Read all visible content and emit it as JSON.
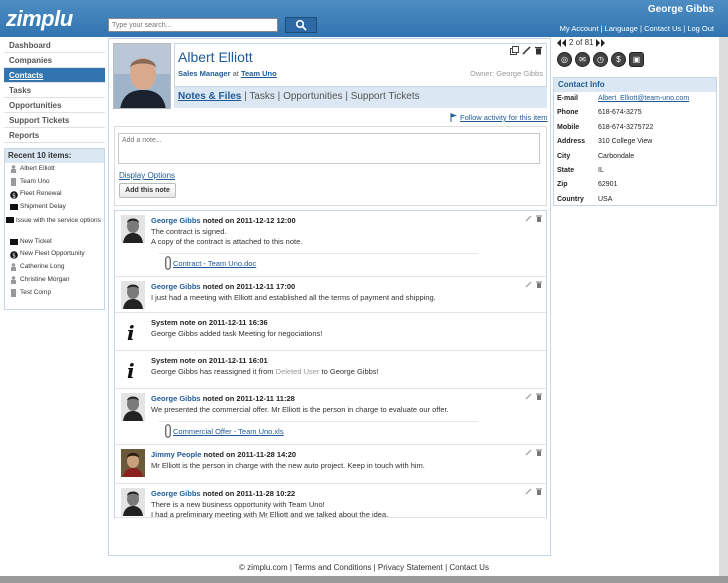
{
  "header": {
    "logo": "zimplu",
    "search_placeholder": "Type your search...",
    "user_name": "George Gibbs",
    "links": [
      "My Account",
      "Language",
      "Contact Us",
      "Log Out"
    ]
  },
  "nav": {
    "items": [
      {
        "label": "Dashboard",
        "active": false
      },
      {
        "label": "Companies",
        "active": false
      },
      {
        "label": "Contacts",
        "active": true
      },
      {
        "label": "Tasks",
        "active": false
      },
      {
        "label": "Opportunities",
        "active": false
      },
      {
        "label": "Support Tickets",
        "active": false
      },
      {
        "label": "Reports",
        "active": false
      }
    ]
  },
  "recent": {
    "title": "Recent 10 items:",
    "items": [
      {
        "label": "Albert Elliott",
        "icon": "person-icon"
      },
      {
        "label": "Team Uno",
        "icon": "building-icon"
      },
      {
        "label": "Fleet Renewal",
        "icon": "dollar-icon"
      },
      {
        "label": "Shipment Delay",
        "icon": "ticket-icon"
      },
      {
        "label": "Issue with the service options",
        "icon": "ticket-icon"
      },
      {
        "label": "New Ticket",
        "icon": "ticket-icon"
      },
      {
        "label": "New Fleet Opportunity",
        "icon": "dollar-icon"
      },
      {
        "label": "Catherine Long",
        "icon": "person-icon"
      },
      {
        "label": "Christine Morgan",
        "icon": "person-icon"
      },
      {
        "label": "Test Comp",
        "icon": "building-icon"
      }
    ]
  },
  "contact": {
    "name": "Albert Elliott",
    "role": "Sales Manager",
    "at": "at",
    "company": "Team Uno",
    "owner": "Owner: George Gibbs"
  },
  "tabs": [
    "Notes & Files",
    "Tasks",
    "Opportunities",
    "Support Tickets"
  ],
  "follow_label": "Follow activity for this item",
  "note": {
    "placeholder": "Add a note...",
    "display_options": "Display Options",
    "add_button": "Add this note"
  },
  "feed": [
    {
      "author": "George Gibbs",
      "verb": "noted on 2011-12-12 12:00",
      "lines": [
        "The contract is signed.",
        "A copy of the contract is attached to this note."
      ],
      "attachment": "Contract - Team Uno.doc",
      "avatar": "gg",
      "system": false
    },
    {
      "author": "George Gibbs",
      "verb": "noted on 2011-12-11 17:00",
      "lines": [
        "I just had a meeting with Elliott and established all the terms of payment and shipping."
      ],
      "attachment": "",
      "avatar": "gg",
      "system": false
    },
    {
      "author": "",
      "verb": "System note on 2011-12-11 16:36",
      "lines": [
        "George Gibbs added task Meeting for negociations!"
      ],
      "attachment": "",
      "avatar": "info",
      "system": true
    },
    {
      "author": "",
      "verb": "System note on 2011-12-11 16:01",
      "lines": [
        "George Gibbs has reassigned it from Deleted User to George Gibbs!"
      ],
      "attachment": "",
      "avatar": "info",
      "system": true
    },
    {
      "author": "George Gibbs",
      "verb": "noted on 2011-12-11 11:28",
      "lines": [
        "We presented the commercial offer. Mr Elliott is the person in charge to evaluate our offer."
      ],
      "attachment": "Commercial Offer - Team Uno.xls",
      "avatar": "gg",
      "system": false
    },
    {
      "author": "Jimmy People",
      "verb": "noted on 2011-11-28 14:20",
      "lines": [
        "Mr Elliott is the person in charge with the new auto project. Keep in touch with him."
      ],
      "attachment": "",
      "avatar": "jp",
      "system": false
    },
    {
      "author": "George Gibbs",
      "verb": "noted on 2011-11-28 10:22",
      "lines": [
        "There is a new business opportunity with Team Uno!",
        "I had a preliminary meeting with Mr Elliott and we talked about the idea."
      ],
      "attachment": "",
      "avatar": "gg",
      "system": false
    }
  ],
  "pager": {
    "text": "2 of 81"
  },
  "contact_info": {
    "title": "Contact Info",
    "rows": [
      {
        "label": "E-mail",
        "value": "Albert_Elliott@team-uno.com",
        "link": true
      },
      {
        "label": "Phone",
        "value": "618-674-3275",
        "link": false
      },
      {
        "label": "Mobile",
        "value": "618-674-3275722",
        "link": false
      },
      {
        "label": "Address",
        "value": "310 College View",
        "link": false
      },
      {
        "label": "City",
        "value": "Carbondale",
        "link": false
      },
      {
        "label": "State",
        "value": "IL",
        "link": false
      },
      {
        "label": "Zip",
        "value": "62901",
        "link": false
      },
      {
        "label": "Country",
        "value": "USA",
        "link": false
      }
    ]
  },
  "footer": {
    "copyright": "© zimplu.com",
    "links": [
      "Terms and Conditions",
      "Privacy Statement",
      "Contact Us"
    ]
  },
  "colors": {
    "brand": "#3174b0",
    "panel": "#dbe7f2",
    "link": "#1f5a96"
  }
}
